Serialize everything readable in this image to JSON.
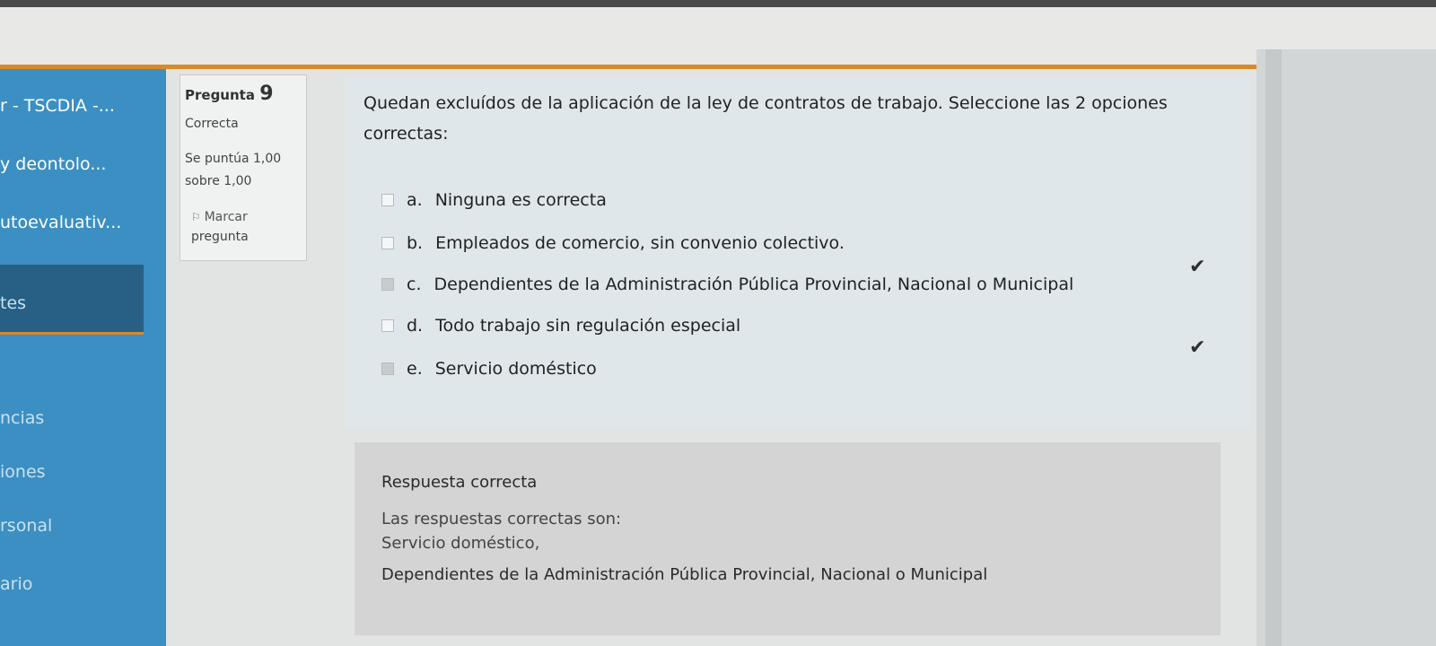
{
  "sidebar": {
    "items": [
      {
        "label": "r - TSCDIA -..."
      },
      {
        "label": " y deontolo..."
      },
      {
        "label": "utoevaluativ..."
      },
      {
        "label": "tes"
      },
      {
        "label": "ncias"
      },
      {
        "label": "iones"
      },
      {
        "label": "rsonal"
      },
      {
        "label": "ario"
      }
    ]
  },
  "question_info": {
    "label": "Pregunta",
    "number": "9",
    "status": "Correcta",
    "score_line1": "Se puntúa 1,00",
    "score_line2": "sobre 1,00",
    "flag_line1": "Marcar",
    "flag_line2": "pregunta"
  },
  "question": {
    "text": "Quedan excluídos de la aplicación de la ley de contratos de trabajo. Seleccione las 2 opciones correctas:",
    "options": [
      {
        "letter": "a.",
        "text": "Ninguna es correcta",
        "checked": false,
        "correct_mark": false
      },
      {
        "letter": "b.",
        "text": "Empleados de comercio, sin convenio colectivo.",
        "checked": false,
        "correct_mark": false
      },
      {
        "letter": "c.",
        "text": "Dependientes de la Administración Pública Provincial, Nacional o Municipal",
        "checked": true,
        "correct_mark": true
      },
      {
        "letter": "d.",
        "text": "Todo trabajo sin regulación especial",
        "checked": false,
        "correct_mark": false
      },
      {
        "letter": "e.",
        "text": "Servicio doméstico",
        "checked": true,
        "correct_mark": true
      }
    ]
  },
  "feedback": {
    "result": "Respuesta correcta",
    "intro": "Las respuestas correctas son:",
    "answer1": "Servicio doméstico,",
    "answer2": "Dependientes de la Administración Pública Provincial, Nacional o Municipal"
  },
  "icons": {
    "check": "checkmark-icon",
    "flag": "flag-icon"
  },
  "colors": {
    "sidebar": "#3b8fc2",
    "sidebar_active": "#285f84",
    "accent": "#d8892a"
  }
}
